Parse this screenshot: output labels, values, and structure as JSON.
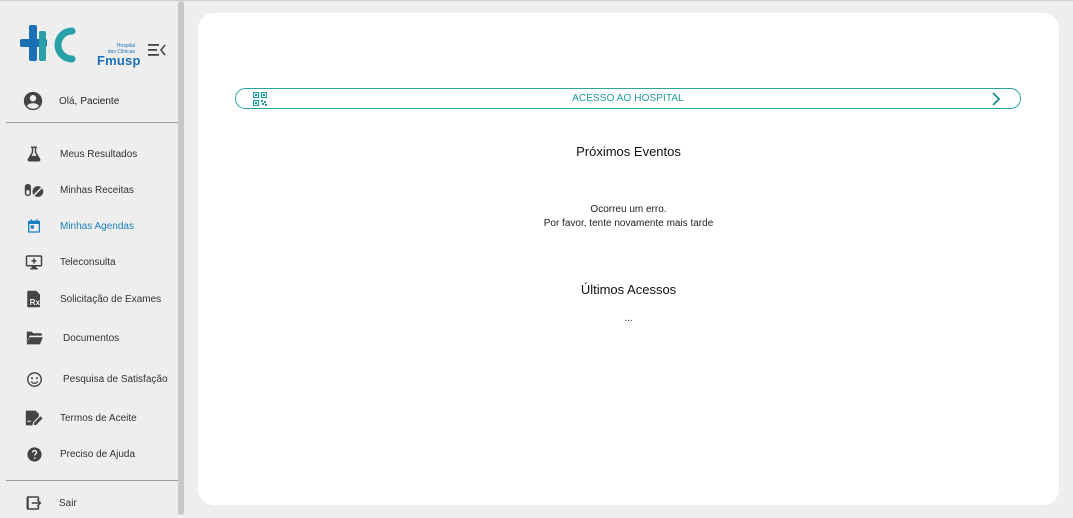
{
  "brand": {
    "logo_small_lines": [
      "Hospital",
      "das Clínicas"
    ],
    "logo_name": "Fmusp",
    "primary_color": "#1a6fb5",
    "accent_color": "#2aa3a3"
  },
  "sidebar": {
    "greeting": "Olá,",
    "user_name": "Paciente",
    "items": [
      {
        "label": "Meus Resultados",
        "icon": "flask-icon"
      },
      {
        "label": "Minhas Receitas",
        "icon": "pills-icon"
      },
      {
        "label": "Minhas Agendas",
        "icon": "calendar-icon",
        "active": true
      },
      {
        "label": "Teleconsulta",
        "icon": "monitor-plus-icon"
      },
      {
        "label": "Solicitação de Exames",
        "icon": "prescription-icon"
      },
      {
        "label": "Documentos",
        "icon": "folder-open-icon"
      },
      {
        "label": "Pesquisa de Satisfação",
        "icon": "smiley-icon"
      },
      {
        "label": "Termos de Aceite",
        "icon": "document-sign-icon"
      },
      {
        "label": "Preciso de Ajuda",
        "icon": "help-circle-icon"
      }
    ],
    "logout": {
      "label": "Sair",
      "icon": "logout-icon"
    }
  },
  "main": {
    "access_button": "ACESSO AO HOSPITAL",
    "upcoming": {
      "title": "Próximos Eventos",
      "error_line1": "Ocorreu um erro.",
      "error_line2": "Por favor, tente novamente mais tarde"
    },
    "recent": {
      "title": "Últimos Acessos",
      "loading": "..."
    }
  }
}
